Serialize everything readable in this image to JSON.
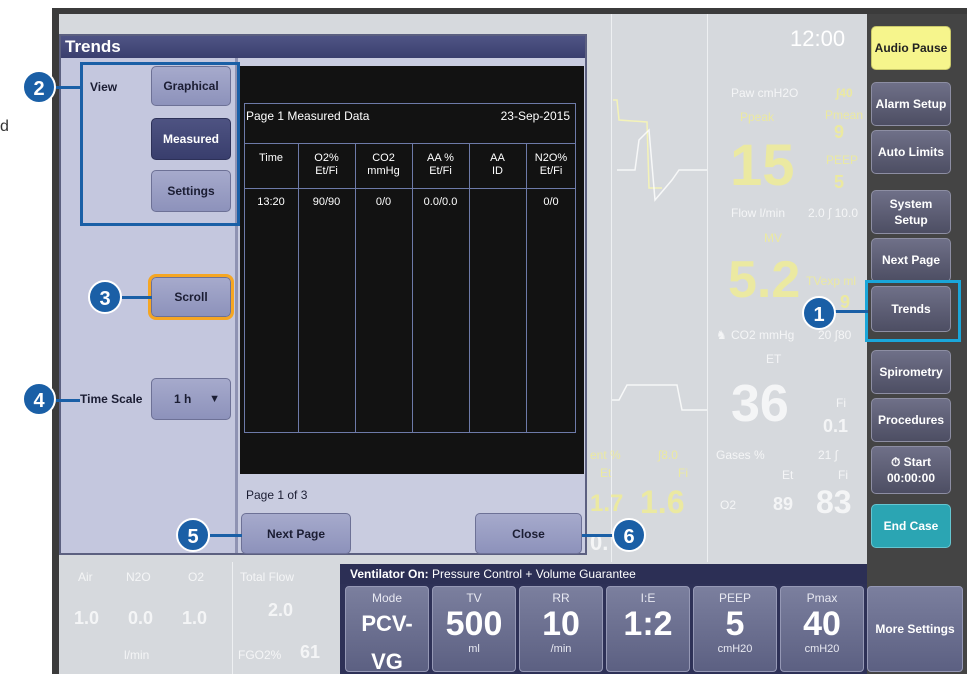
{
  "clock": "12:00",
  "cut_text": "d",
  "side_buttons": {
    "audio_pause": "Audio Pause",
    "alarm_setup": "Alarm Setup",
    "auto_limits": "Auto Limits",
    "system_setup": "System Setup",
    "next_page": "Next Page",
    "trends": "Trends",
    "spirometry": "Spirometry",
    "procedures": "Procedures",
    "start_label": "Start",
    "start_time": "00:00:00",
    "end_case": "End Case"
  },
  "monitor": {
    "paw_label": "Paw cmH2O",
    "paw_limit": "∫40",
    "ppeak_label": "Ppeak",
    "pmean_label": "Pmean",
    "pmean_value": "9",
    "ppeak_value": "15",
    "peep_label": "PEEP",
    "peep_value": "5",
    "flow_label": "Flow l/min",
    "flow_limits": "2.0 ∫ 10.0",
    "mv_label": "MV",
    "mv_value": "5.2",
    "tvexp_label": "TVexp ml",
    "tvexp_value": "9",
    "co2_label": "CO2 mmHg",
    "co2_limits": "20 ∫80",
    "et_label": "ET",
    "co2_et_value": "36",
    "fi_label": "Fi",
    "co2_fi_value": "0.1",
    "agent_label": "ent %",
    "agent_limit": "∫8.0",
    "agent_et": "1.7",
    "agent_fi": "1.6",
    "gases_label": "Gases %",
    "gases_limit": "21 ∫",
    "gas_et_label": "Et",
    "gas_fi_label": "Fi",
    "o2_label": "O2",
    "o2_et": "89",
    "o2_fi": "83",
    "partial_value": "0."
  },
  "flows": {
    "air_label": "Air",
    "n2o_label": "N2O",
    "o2_label": "O2",
    "air_value": "1.0",
    "n2o_value": "0.0",
    "o2_value": "1.0",
    "unit": "l/min",
    "total_flow_label": "Total Flow",
    "total_flow_value": "2.0",
    "fgo2_label": "FGO2%",
    "fgo2_value": "61"
  },
  "dialog": {
    "title": "Trends",
    "view_label": "View",
    "graphical": "Graphical",
    "measured": "Measured",
    "settings": "Settings",
    "scroll": "Scroll",
    "time_scale_label": "Time Scale",
    "time_scale_value": "1 h",
    "next_page": "Next Page",
    "close": "Close",
    "page_info": "Page 1 of 3"
  },
  "table": {
    "title": "Page 1 Measured Data",
    "date": "23-Sep-2015",
    "headers": [
      [
        "Time",
        ""
      ],
      [
        "O2%",
        "Et/Fi"
      ],
      [
        "CO2",
        "mmHg"
      ],
      [
        "AA %",
        "Et/Fi"
      ],
      [
        "AA",
        "ID"
      ],
      [
        "N2O%",
        "Et/Fi"
      ]
    ],
    "rows": [
      [
        "13:20",
        "90/90",
        "0/0",
        "0.0/0.0",
        "",
        "0/0"
      ]
    ]
  },
  "ventilator": {
    "header_bold": "Ventilator On:",
    "header_text": "Pressure Control + Volume Guarantee",
    "mode_label": "Mode",
    "mode_value": "PCV-VG",
    "tv_label": "TV",
    "tv_value": "500",
    "tv_unit": "ml",
    "rr_label": "RR",
    "rr_value": "10",
    "rr_unit": "/min",
    "ie_label": "I:E",
    "ie_value": "1:2",
    "peep_label": "PEEP",
    "peep_value": "5",
    "peep_unit": "cmH20",
    "pmax_label": "Pmax",
    "pmax_value": "40",
    "pmax_unit": "cmH20",
    "more_settings": "More Settings"
  },
  "callouts": [
    "1",
    "2",
    "3",
    "4",
    "5",
    "6"
  ],
  "colors": {
    "callout": "#1a5fa6",
    "trends_highlight": "#1aa6d9",
    "scroll_highlight": "#f5a623",
    "audio_pause": "#f6f58c",
    "end_case": "#2ba5b3"
  }
}
